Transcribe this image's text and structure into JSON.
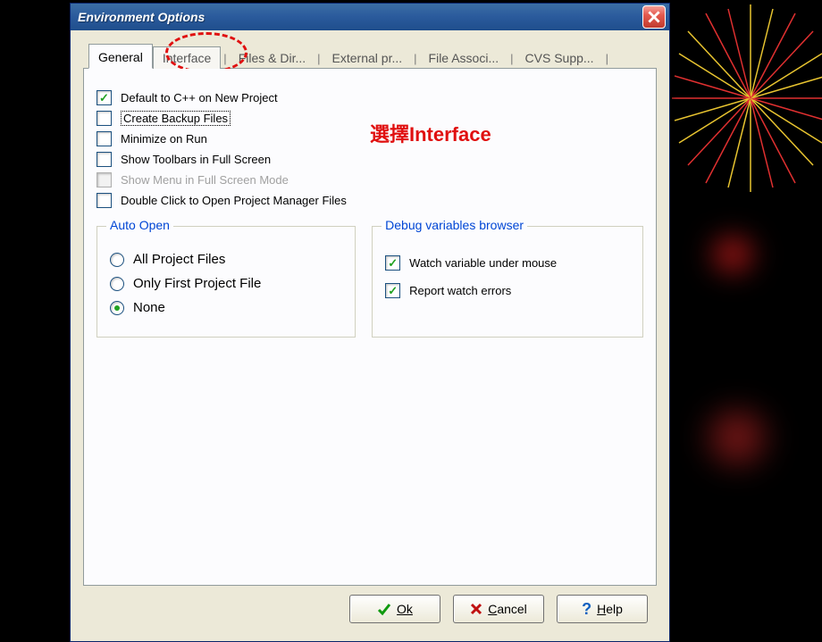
{
  "window": {
    "title": "Environment Options"
  },
  "tabs": [
    {
      "label": "General",
      "active": true
    },
    {
      "label": "Interface"
    },
    {
      "label": "Files & Dir..."
    },
    {
      "label": "External pr..."
    },
    {
      "label": "File Associ..."
    },
    {
      "label": "CVS Supp..."
    }
  ],
  "options": {
    "default_cpp": {
      "label": "Default to C++ on New Project",
      "checked": true
    },
    "backup": {
      "label": "Create Backup Files",
      "checked": false,
      "focused": true
    },
    "minimize": {
      "label": "Minimize on Run",
      "checked": false
    },
    "toolbars_full": {
      "label": "Show Toolbars in Full Screen",
      "checked": false
    },
    "menu_full": {
      "label": "Show Menu in Full Screen Mode",
      "checked": false,
      "disabled": true
    },
    "dblclick_pm": {
      "label": "Double Click to Open Project Manager Files",
      "checked": false
    }
  },
  "auto_open": {
    "legend": "Auto Open",
    "items": [
      {
        "label": "All Project Files",
        "selected": false
      },
      {
        "label": "Only First Project File",
        "selected": false
      },
      {
        "label": "None",
        "selected": true
      }
    ]
  },
  "debug_browser": {
    "legend": "Debug variables browser",
    "watch_mouse": {
      "label": "Watch variable under mouse",
      "checked": true
    },
    "report_err": {
      "label": "Report watch errors",
      "checked": true
    }
  },
  "buttons": {
    "ok": "Ok",
    "cancel": "Cancel",
    "help": "Help"
  },
  "annotation": {
    "text": "選擇Interface"
  }
}
